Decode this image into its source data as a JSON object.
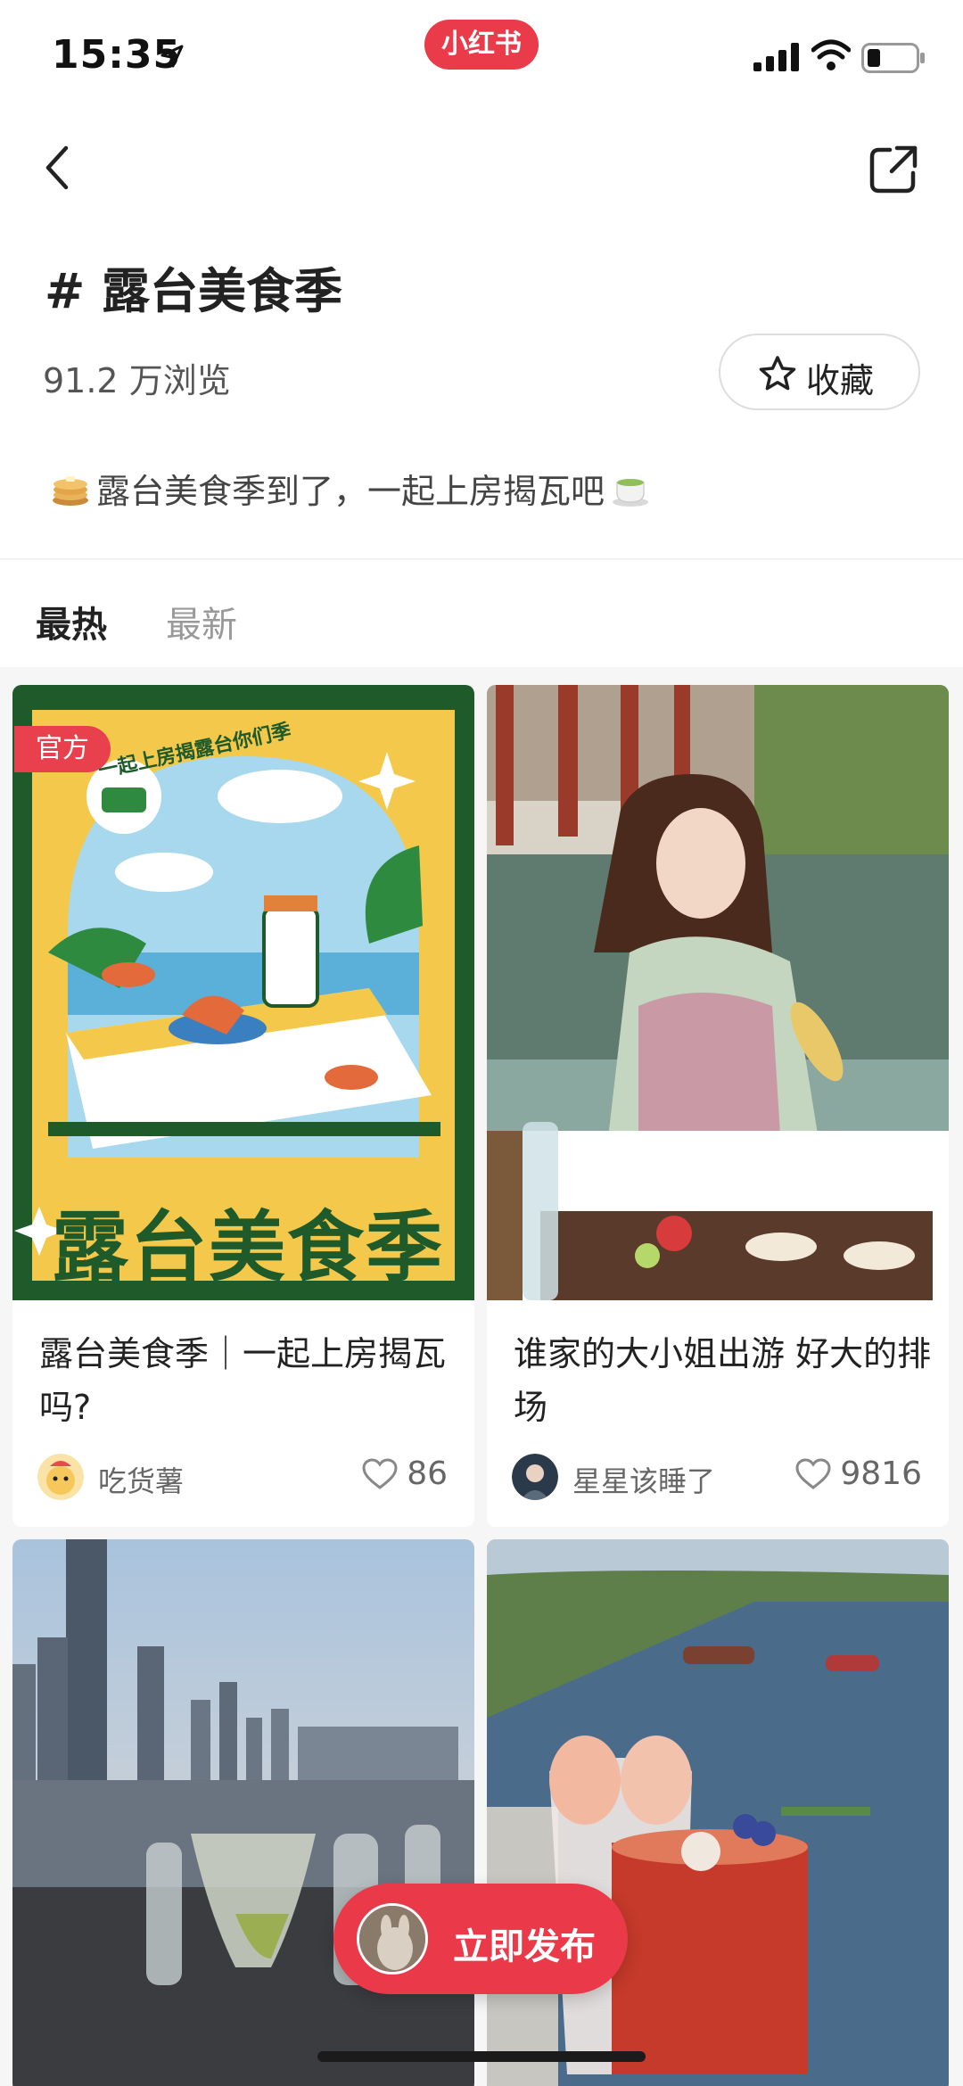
{
  "status_bar": {
    "time": "15:35",
    "app_badge": "小红书"
  },
  "header": {
    "topic_title": "# 露台美食季",
    "views": "91.2 万浏览",
    "favorite_label": "收藏",
    "description": "露台美食季到了，一起上房揭瓦吧"
  },
  "tabs": [
    {
      "label": "最热",
      "active": true
    },
    {
      "label": "最新",
      "active": false
    }
  ],
  "feed": [
    {
      "title": "露台美食季｜一起上房揭瓦吗?",
      "author": "吃货薯",
      "likes": "86",
      "badge": "官方",
      "poster_text": "露台美食季",
      "poster_arc_text": "一起上房揭露台你们季"
    },
    {
      "title": "谁家的大小姐出游 好大的排场",
      "author": "星星该睡了",
      "likes": "9816"
    },
    {
      "title": "",
      "author": "",
      "likes": ""
    },
    {
      "title": "",
      "author": "",
      "likes": ""
    }
  ],
  "publish_button": {
    "label": "立即发布"
  },
  "colors": {
    "brand_red": "#ea3a4a",
    "poster_green": "#1f5a2a",
    "poster_yellow": "#f4c84a"
  }
}
